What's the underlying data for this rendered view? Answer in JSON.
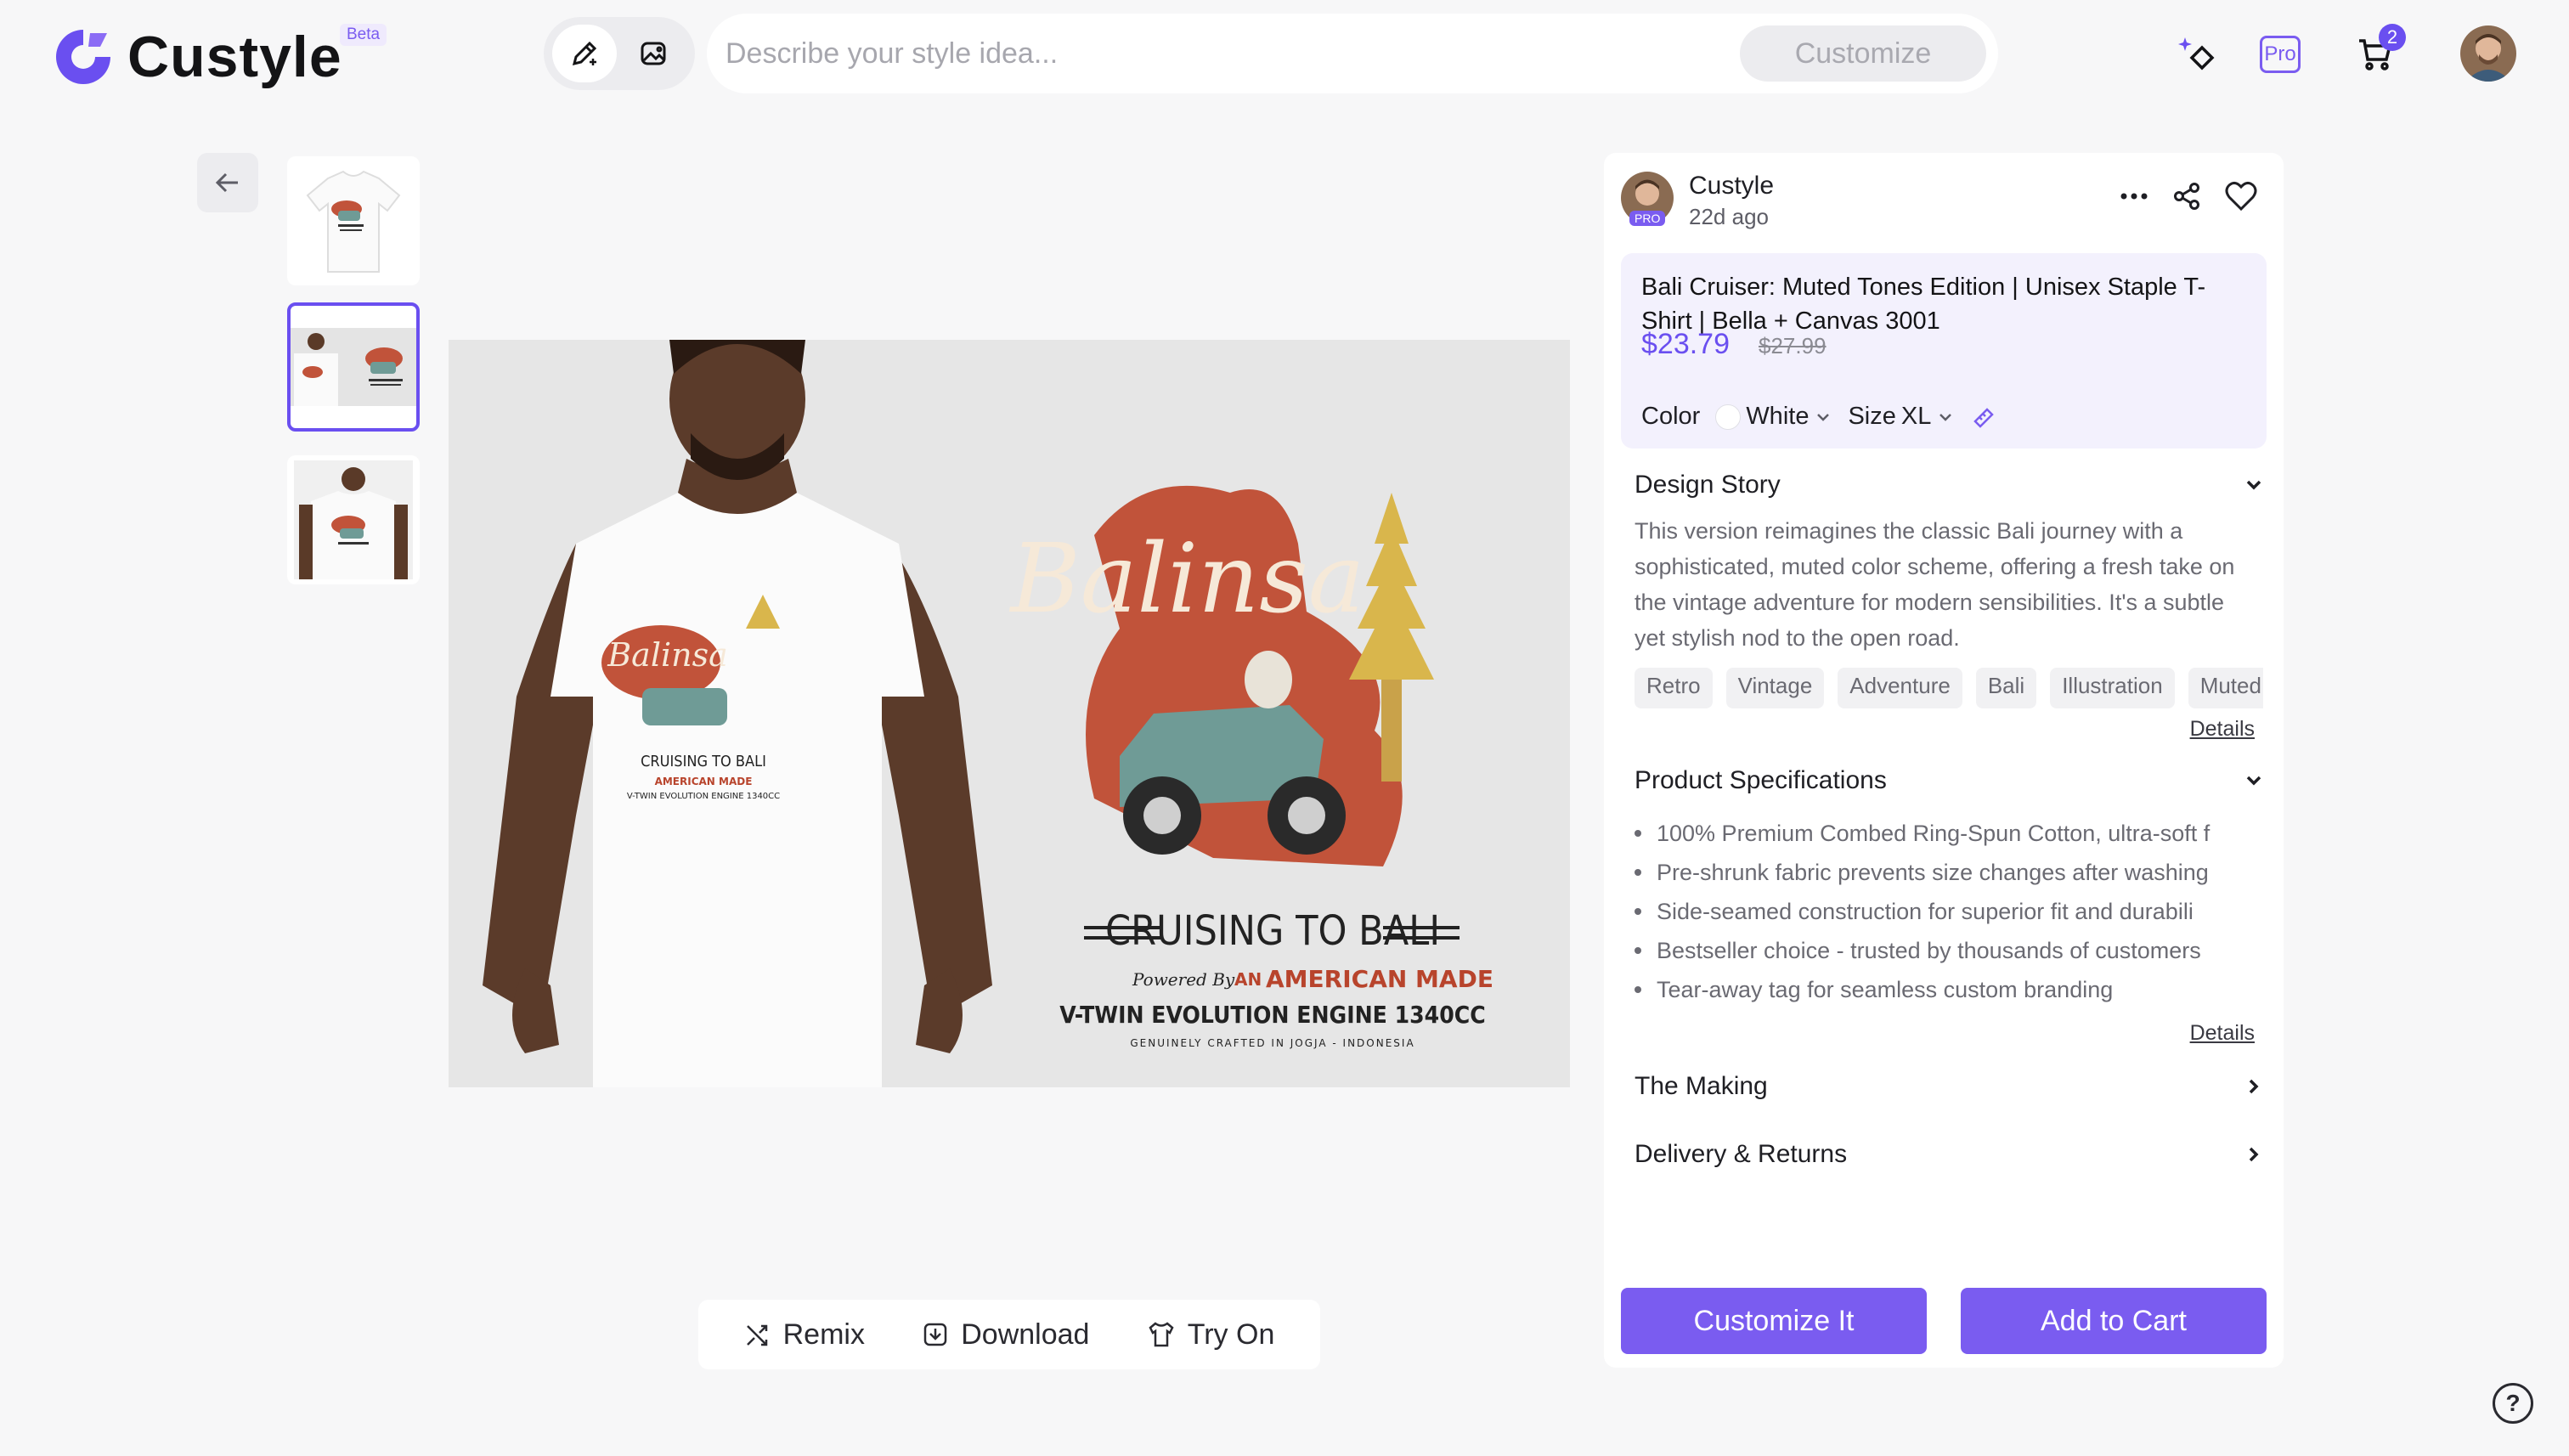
{
  "app": {
    "name": "Custyle",
    "badge": "Beta",
    "brand_color": "#6a4ff0"
  },
  "header": {
    "search": {
      "placeholder": "Describe your style idea...",
      "value": ""
    },
    "customize_label": "Customize",
    "pro_label": "Pro",
    "cart_count": "2",
    "icons": [
      "pencil-sparkle-icon",
      "image-sparkle-icon",
      "sparkle-diamond-icon",
      "cart-icon",
      "avatar"
    ]
  },
  "gallery": {
    "thumbnails": [
      {
        "name": "tshirt-front",
        "selected": false
      },
      {
        "name": "model-with-design",
        "selected": true
      },
      {
        "name": "model-closeup",
        "selected": false
      }
    ],
    "design_text": {
      "script_title": "Balinsa",
      "headline": "CRUISING TO BALI",
      "powered": "Powered By",
      "an": "AN",
      "made": "AMERICAN MADE",
      "engine": "V-TWIN EVOLUTION ENGINE 1340CC",
      "crafted": "GENUINELY CRAFTED IN JOGJA - INDONESIA"
    }
  },
  "actions": {
    "remix": "Remix",
    "download": "Download",
    "try_on": "Try On"
  },
  "product": {
    "seller": {
      "name": "Custyle",
      "posted": "22d ago",
      "pro": "PRO"
    },
    "title": "Bali Cruiser: Muted Tones Edition | Unisex Staple T-Shirt | Bella + Canvas 3001",
    "price": "$23.79",
    "original_price": "$27.99",
    "color_label": "Color",
    "color_value": "White",
    "size_label": "Size",
    "size_value": "XL",
    "sections": {
      "design_story": {
        "title": "Design Story",
        "text": "This version reimagines the classic Bali journey with a sophisticated, muted color scheme, offering a fresh take on the vintage adventure for modern sensibilities. It's a subtle yet stylish nod to the open road.",
        "tags": [
          "Retro",
          "Vintage",
          "Adventure",
          "Bali",
          "Illustration",
          "Muted"
        ],
        "details_label": "Details"
      },
      "specifications": {
        "title": "Product Specifications",
        "items": [
          "100% Premium Combed Ring-Spun Cotton, ultra-soft f",
          "Pre-shrunk fabric prevents size changes after washing",
          "Side-seamed construction for superior fit and durabili",
          "Bestseller choice - trusted by thousands of customers",
          "Tear-away tag for seamless custom branding"
        ],
        "details_label": "Details"
      },
      "making": {
        "title": "The Making"
      },
      "delivery": {
        "title": "Delivery & Returns"
      }
    },
    "customize_button": "Customize It",
    "add_to_cart_button": "Add to Cart"
  },
  "help_label": "?"
}
